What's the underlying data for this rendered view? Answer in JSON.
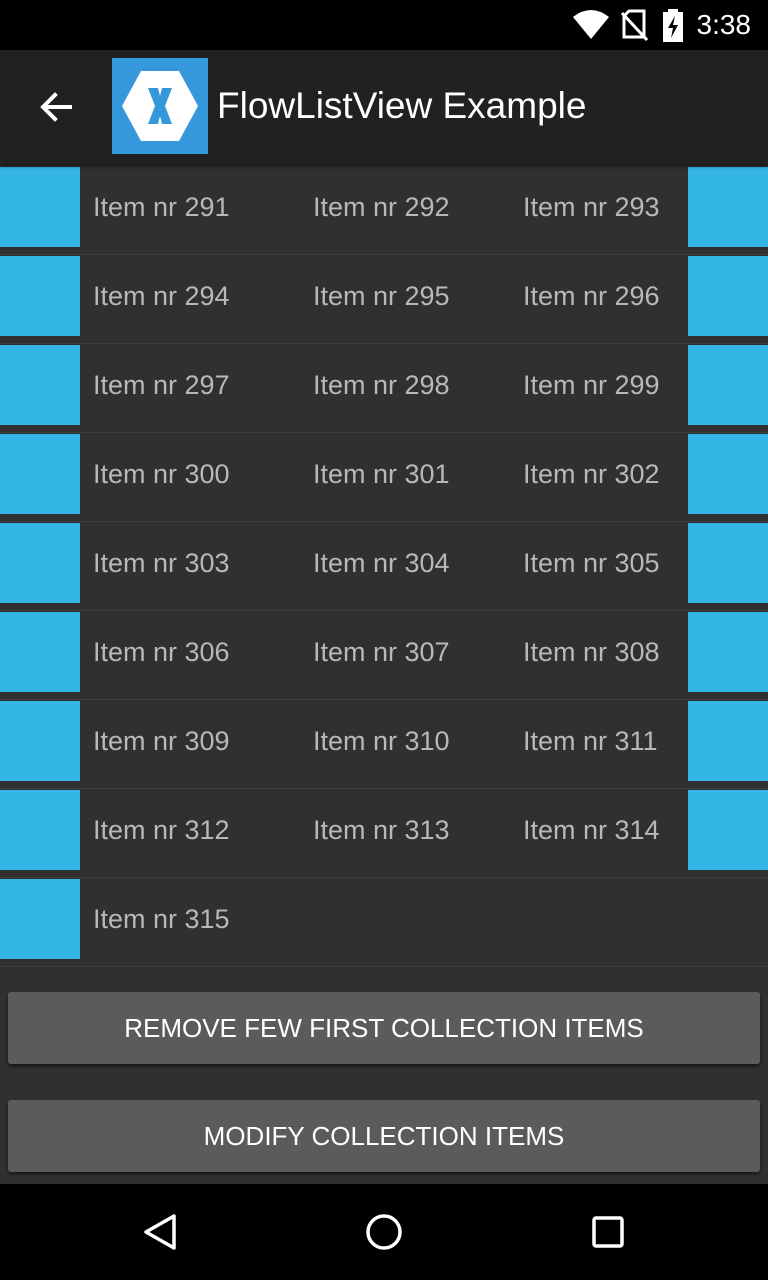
{
  "status_bar": {
    "time": "3:38",
    "icons": [
      "wifi-icon",
      "no-sim-icon",
      "battery-charging-icon"
    ]
  },
  "app_bar": {
    "title": "FlowListView Example",
    "back_icon": "arrow-back-icon",
    "logo_icon": "xamarin-logo-icon"
  },
  "list": {
    "rows": [
      {
        "items": [
          "Item nr 291",
          "Item nr 292",
          "Item nr 293"
        ]
      },
      {
        "items": [
          "Item nr 294",
          "Item nr 295",
          "Item nr 296"
        ]
      },
      {
        "items": [
          "Item nr 297",
          "Item nr 298",
          "Item nr 299"
        ]
      },
      {
        "items": [
          "Item nr 300",
          "Item nr 301",
          "Item nr 302"
        ]
      },
      {
        "items": [
          "Item nr 303",
          "Item nr 304",
          "Item nr 305"
        ]
      },
      {
        "items": [
          "Item nr 306",
          "Item nr 307",
          "Item nr 308"
        ]
      },
      {
        "items": [
          "Item nr 309",
          "Item nr 310",
          "Item nr 311"
        ]
      },
      {
        "items": [
          "Item nr 312",
          "Item nr 313",
          "Item nr 314"
        ]
      },
      {
        "items": [
          "Item nr 315"
        ]
      }
    ]
  },
  "buttons": {
    "remove_label": "REMOVE FEW FIRST COLLECTION ITEMS",
    "modify_label": "MODIFY COLLECTION ITEMS"
  },
  "nav_bar": {
    "icons": [
      "back-triangle-icon",
      "home-circle-icon",
      "recents-square-icon"
    ]
  },
  "colors": {
    "accent_block": "#33b5e5",
    "logo_background": "#3498db",
    "app_bar": "#212121",
    "list_background": "#303030",
    "button": "#5b5b5b"
  }
}
